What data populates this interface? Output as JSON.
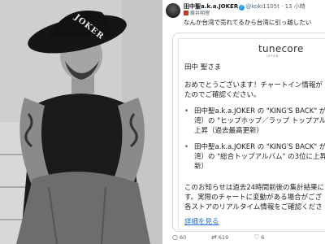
{
  "author": {
    "name": "田中聖a.k.a.JOKER",
    "handle": "@koki1105t",
    "time": "· 13 小時",
    "badge": "藤井翔理"
  },
  "post_text": "なんか台湾で売れてるから台湾に引っ越したい",
  "photo": {
    "hat_text": "JOKER"
  },
  "card": {
    "logo": "tunecore",
    "logo_sub": "JAPAN",
    "greeting": "田中 聖さま",
    "lines": [
      "おめでとうございます！チャートイン情報が",
      "たのでご確認ください。"
    ],
    "bullet1": [
      "田中聖a.k.a.JOKER の \"KING'S BACK\" が（",
      "湾）の \"ヒップホップ／ラップ トップアルバ",
      "上昇（過去最高更新）"
    ],
    "bullet2": [
      "田中聖a.k.a.JOKER の \"KING'S BACK\" が（",
      "湾）の \"総合トップアルバム\" の3位に上昇（",
      "新）"
    ],
    "notice": [
      "このお知らせは過去24時間前後の集計結果に",
      "す。実際のチャートに変動がある場合がござ",
      "各ストアのリアルタイム情報をご確認くださ"
    ],
    "details": "詳細を見る"
  },
  "actions": {
    "reply": "60",
    "retweet": "619",
    "like": "6"
  }
}
